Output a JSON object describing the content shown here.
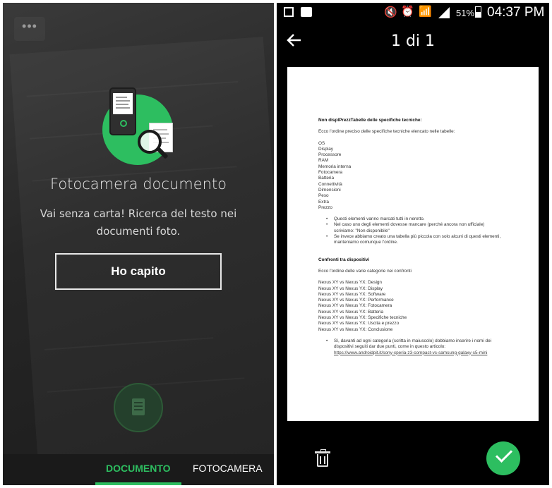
{
  "left_panel": {
    "menu_icon": "more-dots-icon",
    "hero_icon": "phone-document-search-icon",
    "title": "Fotocamera documento",
    "subtitle": "Vai senza carta! Ricerca del testo nei documenti foto.",
    "button_label": "Ho capito",
    "shutter_icon": "document-shutter-icon",
    "tabs": [
      {
        "label": "DOCUMENTO",
        "active": true
      },
      {
        "label": "FOTOCAMERA",
        "active": false
      }
    ]
  },
  "right_panel": {
    "status_bar": {
      "icons": [
        "gallery-icon",
        "bag-icon",
        "mute-icon",
        "alarm-icon",
        "wifi-icon",
        "signal-icon",
        "battery-icon"
      ],
      "battery": "51%",
      "time": "04:37 PM"
    },
    "toolbar": {
      "back_icon": "arrow-left-icon",
      "title": "1 di 1"
    },
    "document": {
      "heading1": "Non displPrezzTabelle delle specifiche tecniche:",
      "intro1": "Ecco l'ordine preciso delle specifiche tecniche elencato nelle tabelle:",
      "spec_list": [
        "OS",
        "Display",
        "Processore",
        "RAM",
        "Memoria interna",
        "Fotocamera",
        "Batteria",
        "Connettività",
        "Dimensioni",
        "Peso",
        "Extra",
        "Prezzo"
      ],
      "bullets1": [
        "Questi elementi vanno marcati tutti in neretto.",
        "Nel caso uno degli elementi dovesse mancare (perché ancora non ufficiale) scriviamo: \"Non disponibile\"",
        "Se invece abbiamo creato una tabella più piccola con solo alcuni di questi elementi, manteniamo comunque l'ordine."
      ],
      "heading2": "Confronti tra dispositivi",
      "intro2": "Ecco l'ordine delle varie categorie nei confronti",
      "compare_list": [
        "Nexus XY vs Nexus YX: Design",
        "Nexus XY vs Nexus YX: Display",
        "Nexus XY vs Nexus YX: Software",
        "Nexus XY vs Nexus YX: Performance",
        "Nexus XY vs Nexus YX: Fotocamera",
        "Nexus XY vs Nexus YX: Batteria",
        "Nexus XY vs Nexus YX: Specifiche tecniche",
        "Nexus XY vs Nexus YX: Uscita e prezzo",
        "Nexus XY vs Nexus YX: Conclusione"
      ],
      "bullet2": "Sì, davanti ad ogni categoria (scritta in maiuscolo) dobbiamo inserire i nomi dei dispositivi seguiti dar due punti, come in questo articolo:",
      "link": "https://www.androidpit.it/sony-xperia-z3-compact-vs-samsung-galaxy-s5-mini"
    },
    "delete_icon": "trash-icon",
    "confirm_icon": "checkmark-icon"
  },
  "colors": {
    "accent_green": "#2dbe60",
    "dark_bg": "#2a2a2a",
    "black": "#000000"
  }
}
